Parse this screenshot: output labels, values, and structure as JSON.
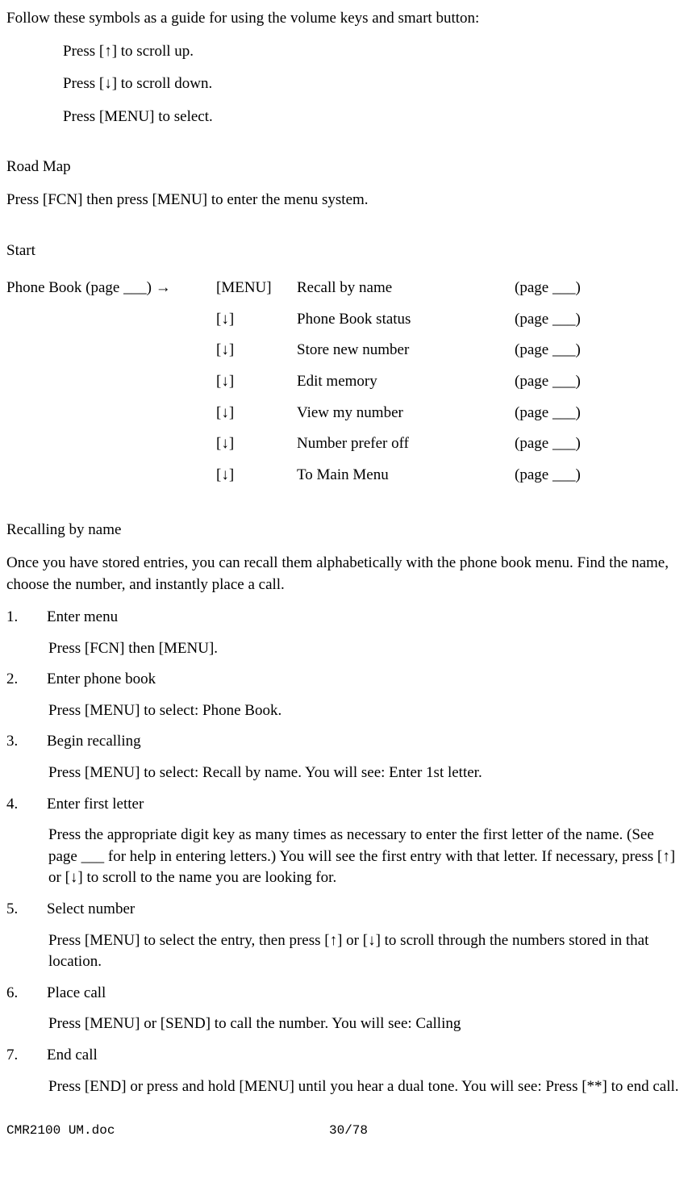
{
  "intro": "Follow these symbols as a guide for using the volume keys and smart button:",
  "bullets": {
    "b1": "Press [↑] to scroll up.",
    "b2": "Press [↓] to scroll down.",
    "b3": "Press [MENU] to select."
  },
  "roadmap": {
    "heading": "Road Map",
    "text": "Press [FCN] then press [MENU] to enter the menu system."
  },
  "start": {
    "heading": "Start",
    "first_col": "Phone Book (page ___) →",
    "rows": [
      {
        "key": "[MENU]",
        "func": "Recall by name",
        "page": "(page ___)"
      },
      {
        "key": "[↓]",
        "func": "Phone Book status",
        "page": "(page ___)"
      },
      {
        "key": "[↓]",
        "func": "Store new number",
        "page": "(page ___)"
      },
      {
        "key": "[↓]",
        "func": "Edit memory",
        "page": "(page ___)"
      },
      {
        "key": "[↓]",
        "func": "View my number",
        "page": "(page ___)"
      },
      {
        "key": "[↓]",
        "func": "Number prefer off",
        "page": "(page ___)"
      },
      {
        "key": "[↓]",
        "func": "To Main Menu",
        "page": "(page ___)"
      }
    ]
  },
  "recalling": {
    "heading": "Recalling by name",
    "intro": "Once you have stored entries, you can recall them alphabetically with the phone book menu. Find the name, choose the number, and instantly place a call.",
    "steps": [
      {
        "num": "1.",
        "title": "Enter menu",
        "body": "Press [FCN] then [MENU]."
      },
      {
        "num": "2.",
        "title": "Enter phone book",
        "body": "Press [MENU] to select: Phone Book."
      },
      {
        "num": "3.",
        "title": "Begin recalling",
        "body": "Press [MENU] to select: Recall by name. You will see: Enter 1st letter."
      },
      {
        "num": "4.",
        "title": "Enter first letter",
        "body": "Press the appropriate digit key as many times as necessary to enter the first letter of the name. (See page ___ for help in entering letters.) You will see the first entry with that letter. If necessary, press [↑] or [↓] to scroll to the name you are looking for."
      },
      {
        "num": "5.",
        "title": "Select number",
        "body": "Press [MENU] to select the entry, then press [↑] or [↓] to scroll through the numbers stored in that location."
      },
      {
        "num": "6.",
        "title": "Place call",
        "body": "Press [MENU] or [SEND] to call the number. You will see: Calling"
      },
      {
        "num": "7.",
        "title": "End call",
        "body": "Press [END] or press and hold [MENU] until you hear a dual tone. You will see: Press [**] to end call."
      }
    ]
  },
  "footer": {
    "file": "CMR2100 UM.doc",
    "page": "30/78"
  }
}
